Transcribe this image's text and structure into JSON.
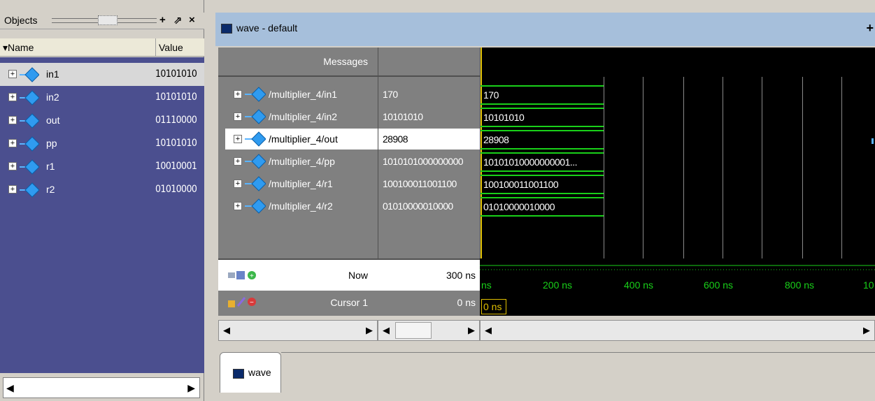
{
  "objects_panel": {
    "title": "Objects",
    "controls": [
      "+",
      "⇗",
      "×"
    ],
    "col_name": "Name",
    "col_value": "Value",
    "rows": [
      {
        "name": "in1",
        "value": "10101010"
      },
      {
        "name": "in2",
        "value": "10101010"
      },
      {
        "name": "out",
        "value": "01110000"
      },
      {
        "name": "pp",
        "value": "10101010"
      },
      {
        "name": "r1",
        "value": "10010001"
      },
      {
        "name": "r2",
        "value": "01010000"
      }
    ]
  },
  "wave_window": {
    "title": "wave - default",
    "messages_header": "Messages",
    "signals": [
      {
        "name": "/multiplier_4/in1",
        "value": "170",
        "wave_label": "170"
      },
      {
        "name": "/multiplier_4/in2",
        "value": "10101010",
        "wave_label": "10101010"
      },
      {
        "name": "/multiplier_4/out",
        "value": "28908",
        "wave_label": "28908"
      },
      {
        "name": "/multiplier_4/pp",
        "value": "1010101000000000",
        "wave_label": "10101010000000001..."
      },
      {
        "name": "/multiplier_4/r1",
        "value": "100100011001100",
        "wave_label": "100100011001100"
      },
      {
        "name": "/multiplier_4/r2",
        "value": "01010000010000",
        "wave_label": "01010000010000"
      }
    ],
    "now_label": "Now",
    "now_value": "300 ns",
    "cursor_label": "Cursor 1",
    "cursor_value": "0 ns",
    "cursor_marker": "0 ns",
    "timeline_ticks": [
      "ns",
      "200 ns",
      "400 ns",
      "600 ns",
      "800 ns",
      "10"
    ],
    "tab_label": "wave"
  }
}
